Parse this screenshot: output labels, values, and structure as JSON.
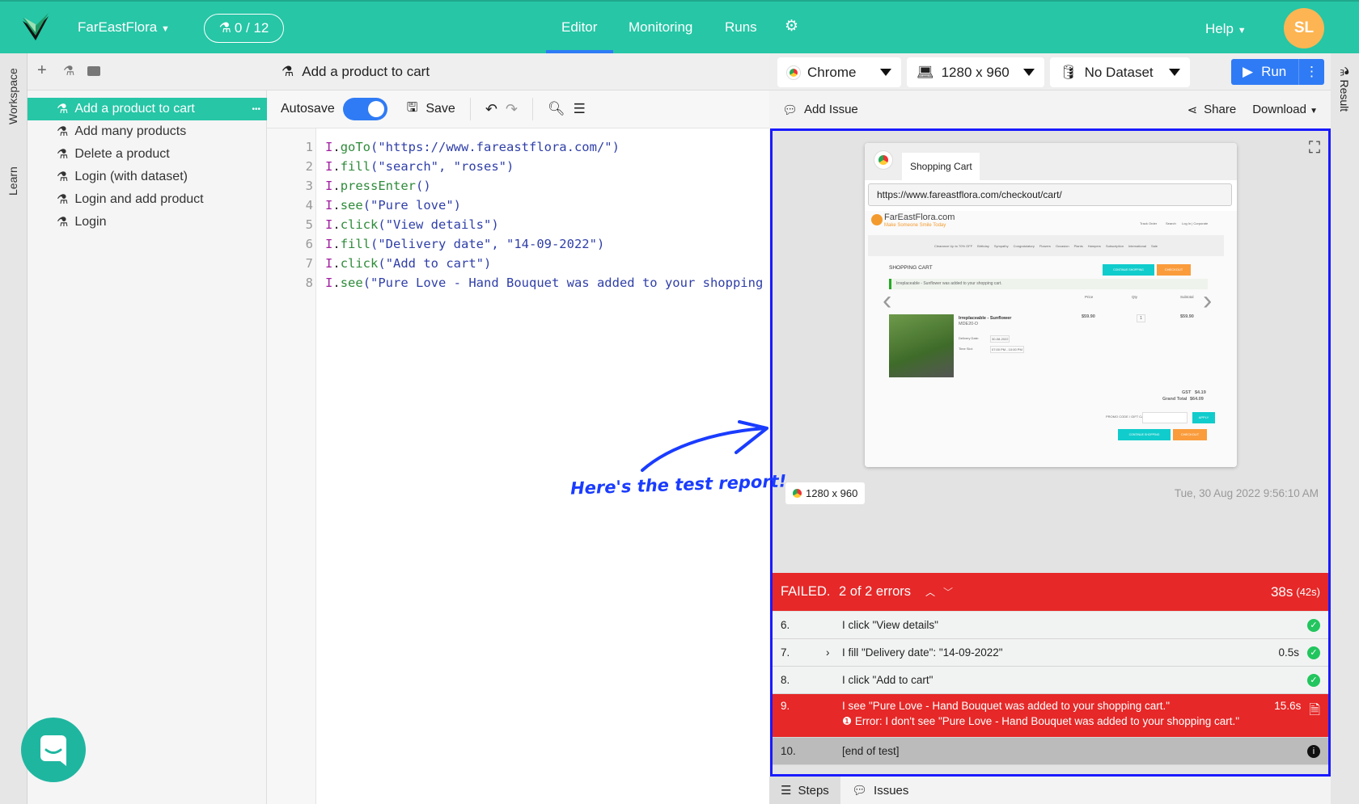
{
  "header": {
    "project": "FarEastFlora",
    "tests_badge": "0 / 12",
    "tabs": [
      "Editor",
      "Monitoring",
      "Runs"
    ],
    "active_tab": "Editor",
    "help": "Help",
    "avatar_initials": "SL",
    "brand_color": "#26c6a6"
  },
  "vertical_tabs": {
    "workspace": "Workspace",
    "learn": "Learn",
    "result": "Result"
  },
  "sidebar": {
    "items": [
      {
        "label": "Add a product to cart",
        "selected": true
      },
      {
        "label": "Add many products"
      },
      {
        "label": "Delete a product"
      },
      {
        "label": "Login (with dataset)"
      },
      {
        "label": "Login and add product"
      },
      {
        "label": "Login"
      }
    ],
    "more": "•••"
  },
  "editor": {
    "title": "Add a product to cart",
    "autosave": "Autosave",
    "autosave_on": true,
    "save": "Save",
    "lines": [
      {
        "n": "1",
        "fn": "goTo",
        "args": "(\"https://www.fareastflora.com/\")"
      },
      {
        "n": "2",
        "fn": "fill",
        "args": "(\"search\", \"roses\")"
      },
      {
        "n": "3",
        "fn": "pressEnter",
        "args": "()"
      },
      {
        "n": "4",
        "fn": "see",
        "args": "(\"Pure love\")"
      },
      {
        "n": "5",
        "fn": "click",
        "args": "(\"View details\")"
      },
      {
        "n": "6",
        "fn": "fill",
        "args": "(\"Delivery date\", \"14-09-2022\")"
      },
      {
        "n": "7",
        "fn": "click",
        "args": "(\"Add to cart\")"
      },
      {
        "n": "8",
        "fn": "see",
        "args": "(\"Pure Love - Hand Bouquet was added to your shopping cart.\")"
      }
    ],
    "obj": "I",
    "dot": "."
  },
  "toolbar": {
    "browser": "Chrome",
    "resolution": "1280 x 960",
    "dataset": "No Dataset",
    "run": "Run",
    "add_issue": "Add Issue",
    "share": "Share",
    "download": "Download"
  },
  "report": {
    "screenshot": {
      "tab_title": "Shopping Cart",
      "url": "https://www.fareastflora.com/checkout/cart/",
      "site_name": "FarEastFlora.com",
      "tagline": "Make Someone Smile Today",
      "top_links": [
        "Track Order",
        "Search",
        "Log In | Corporate"
      ],
      "nav": [
        "Clearance Up to 70% OFF",
        "Birthday",
        "Sympathy",
        "Congratulatory",
        "Flowers",
        "Occasion",
        "Plants",
        "Hampers",
        "Subscription",
        "International",
        "Sale"
      ],
      "heading": "SHOPPING CART",
      "continue": "CONTINUE SHOPPING",
      "checkout": "CHECKOUT",
      "notice": "Irreplaceable - Sunflower was added to your shopping cart.",
      "cols": [
        "Price",
        "Qty",
        "Subtotal"
      ],
      "product": "Irreplaceable - Sunflower",
      "sku": "MDE20-D",
      "price": "$59.90",
      "qty": "1",
      "subtotal": "$59.90",
      "delivery_label": "Delivery Date:",
      "delivery": "30-08-2022",
      "slot_label": "Time Slot:",
      "slot": "07:00 PM - 10:00 PM",
      "gst_label": "GST",
      "gst": "$4.19",
      "total_label": "Grand Total",
      "total": "$64.09",
      "promo": "PROMO CODE / GIFT CARD",
      "apply": "APPLY"
    },
    "resolution_badge": "1280 x 960",
    "timestamp": "Tue, 30 Aug 2022 9:56:10 AM",
    "status": "FAILED.",
    "errors": "2 of 2 errors",
    "duration": "38s",
    "total_duration": "(42s)",
    "steps": [
      {
        "n": "6.",
        "text": "I click \"View details\"",
        "time": "",
        "status": "pass"
      },
      {
        "n": "7.",
        "text": "I fill \"Delivery date\": \"14-09-2022\"",
        "time": "0.5s",
        "status": "pass",
        "expandable": true
      },
      {
        "n": "8.",
        "text": "I click \"Add to cart\"",
        "time": "",
        "status": "pass"
      },
      {
        "n": "9.",
        "text": "I see \"Pure Love - Hand Bouquet was added to your shopping cart.\"",
        "time": "15.6s",
        "status": "fail",
        "error": "Error: I don't see \"Pure Love - Hand Bouquet was added to your shopping cart.\""
      },
      {
        "n": "10.",
        "text": "[end of test]",
        "time": "",
        "status": "info"
      }
    ],
    "tabs": [
      "Steps",
      "Issues"
    ]
  },
  "annotation": "Here's the test report!"
}
